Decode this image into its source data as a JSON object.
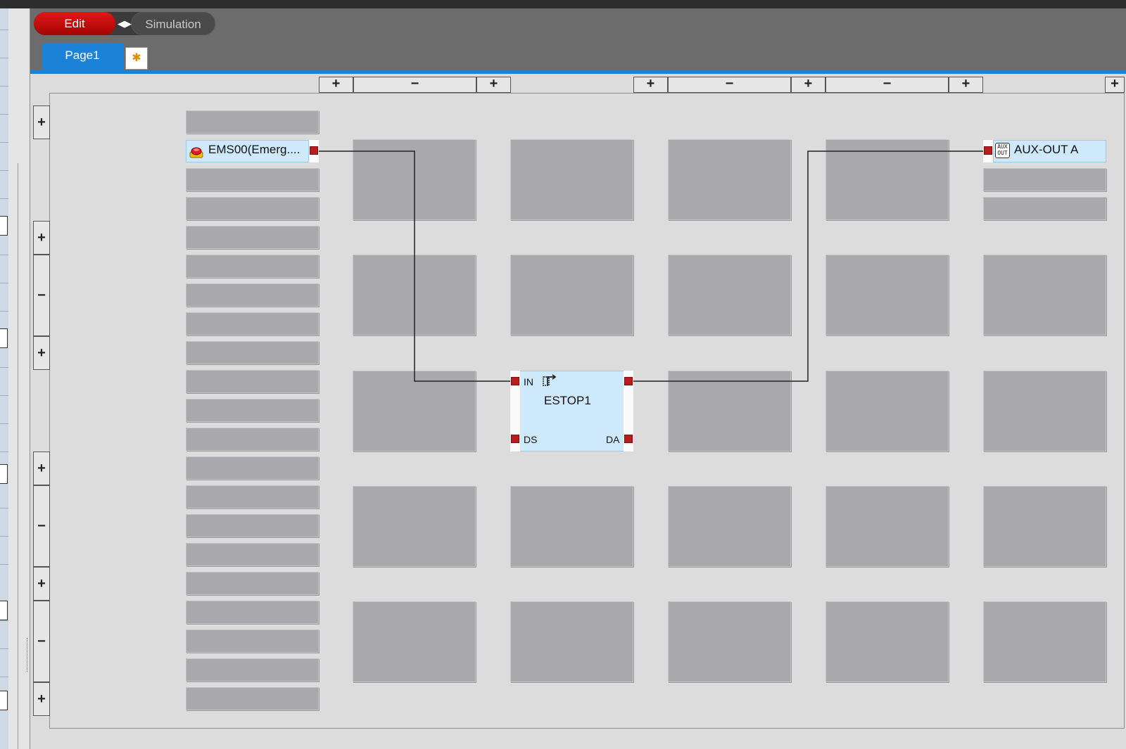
{
  "toolbar": {
    "edit_label": "Edit",
    "simulation_label": "Simulation",
    "toggle_arrows": "◀▶"
  },
  "tabs": [
    {
      "label": "Page1"
    }
  ],
  "add_page_icon": "✱",
  "controls": {
    "plus": "+",
    "minus": "−"
  },
  "inputs": [
    {
      "label": "EMS00(Emerg....",
      "icon": "emergency-stop-button-icon"
    }
  ],
  "function_block": {
    "name": "ESTOP1",
    "icon": "estop-function-icon",
    "ports": {
      "in": "IN",
      "ds": "DS",
      "da": "DA"
    }
  },
  "outputs": [
    {
      "label": "AUX-OUT A",
      "icon": "aux-out-icon",
      "icon_text": "AUX\nOUT"
    }
  ],
  "colors": {
    "edit": "#d10b0b",
    "tab": "#1b82d8",
    "port": "#b81d1d",
    "block": "#cde9fb",
    "slot": "#a9a9ad"
  }
}
